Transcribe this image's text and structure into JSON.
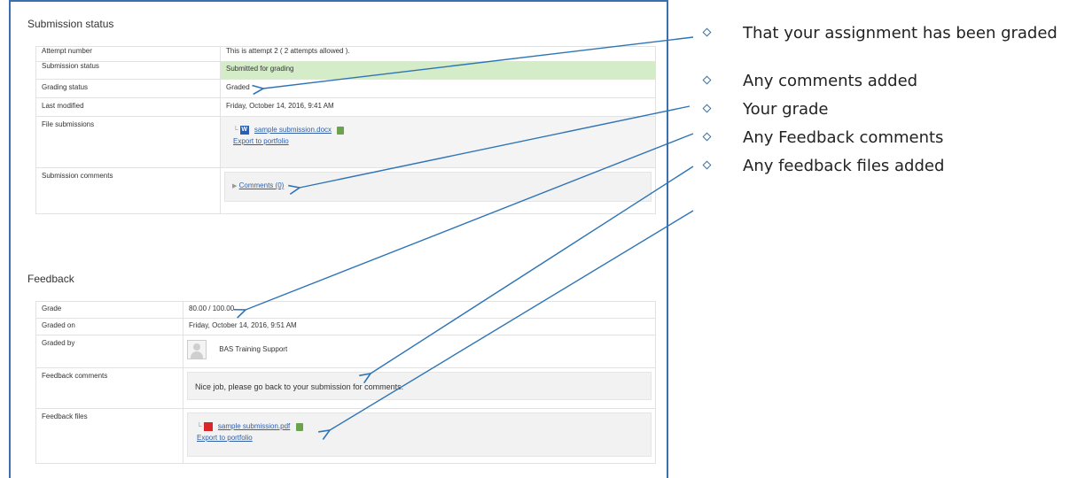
{
  "submission": {
    "heading": "Submission status",
    "rows": {
      "attempt_label": "Attempt number",
      "attempt_value": "This is attempt 2 ( 2 attempts allowed ).",
      "status_label": "Submission status",
      "status_value": "Submitted for grading",
      "grading_label": "Grading status",
      "grading_value": "Graded",
      "modified_label": "Last modified",
      "modified_value": "Friday, October 14, 2016, 9:41 AM",
      "files_label": "File submissions",
      "file_name": "sample submission.docx",
      "export_link": "Export to portfolio",
      "comments_label": "Submission comments",
      "comments_link": "Comments (0)"
    },
    "status_color": "#d4ecc7"
  },
  "feedback": {
    "heading": "Feedback",
    "rows": {
      "grade_label": "Grade",
      "grade_value": "80.00 / 100.00",
      "graded_on_label": "Graded on",
      "graded_on_value": "Friday, October 14, 2016, 9:51 AM",
      "graded_by_label": "Graded by",
      "graded_by_value": "BAS Training Support",
      "comments_label": "Feedback comments",
      "comments_value": "Nice job, please go back to your submission for comments.",
      "files_label": "Feedback files",
      "file_name": "sample submission.pdf",
      "export_link": "Export to portfolio"
    }
  },
  "callouts": [
    "That your assignment has been graded",
    "Any comments added",
    "Your grade",
    "Any Feedback comments",
    "Any feedback files added"
  ],
  "colors": {
    "frame_border": "#3b6fb0",
    "arrow": "#2e74b5",
    "link": "#2e5fa8"
  }
}
